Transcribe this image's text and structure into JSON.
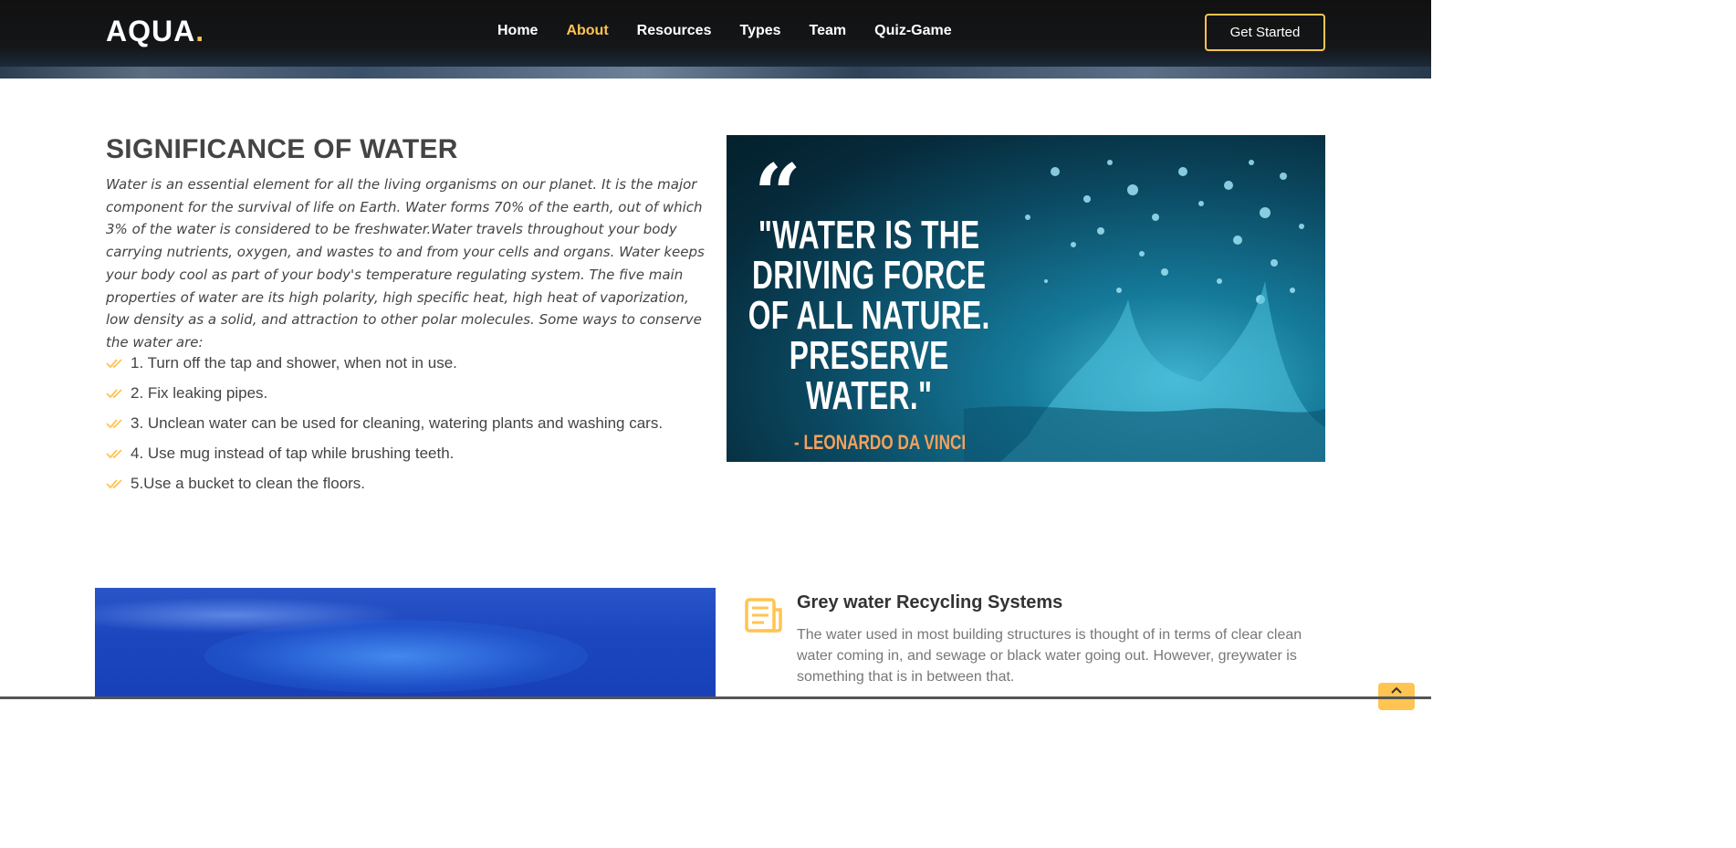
{
  "header": {
    "logo_text": "AQUA",
    "logo_dot": ".",
    "nav": [
      "Home",
      "About",
      "Resources",
      "Types",
      "Team",
      "Quiz-Game"
    ],
    "active_nav": "About",
    "cta_label": "Get Started"
  },
  "about": {
    "title": "SIGNIFICANCE OF WATER",
    "description": "Water is an essential element for all the living organisms on our planet. It is the major component for the survival of life on Earth. Water forms 70% of the earth, out of which 3% of the water is considered to be freshwater.Water travels throughout your body carrying nutrients, oxygen, and wastes to and from your cells and organs. Water keeps your body cool as part of your body's temperature regulating system. The five main properties of water are its high polarity, high specific heat, high heat of vaporization, low density as a solid, and attraction to other polar molecules. Some ways to conserve the water are:",
    "tips": [
      "1. Turn off the tap and shower, when not in use.",
      "2. Fix leaking pipes.",
      "3. Unclean water can be used for cleaning, watering plants and washing cars.",
      "4. Use mug instead of tap while brushing teeth.",
      "5.Use a bucket to clean the floors."
    ],
    "quote_image": {
      "quote_mark": "“",
      "quote_lines": [
        "\"WATER IS THE",
        "DRIVING FORCE",
        "OF ALL NATURE.",
        "PRESERVE",
        "WATER.\""
      ],
      "author": "- LEONARDO DA VINCI"
    }
  },
  "feature": {
    "title": "Grey water Recycling Systems",
    "description": "The water used in most building structures is thought of in terms of clear clean water coming in, and sewage or black water going out. However, greywater is something that is in between that.",
    "icon": "document-icon"
  },
  "colors": {
    "accent": "#ffc451",
    "header_bg": "#111111",
    "text": "#444444",
    "muted_text": "#777777",
    "quote_author": "#f4a15c"
  }
}
